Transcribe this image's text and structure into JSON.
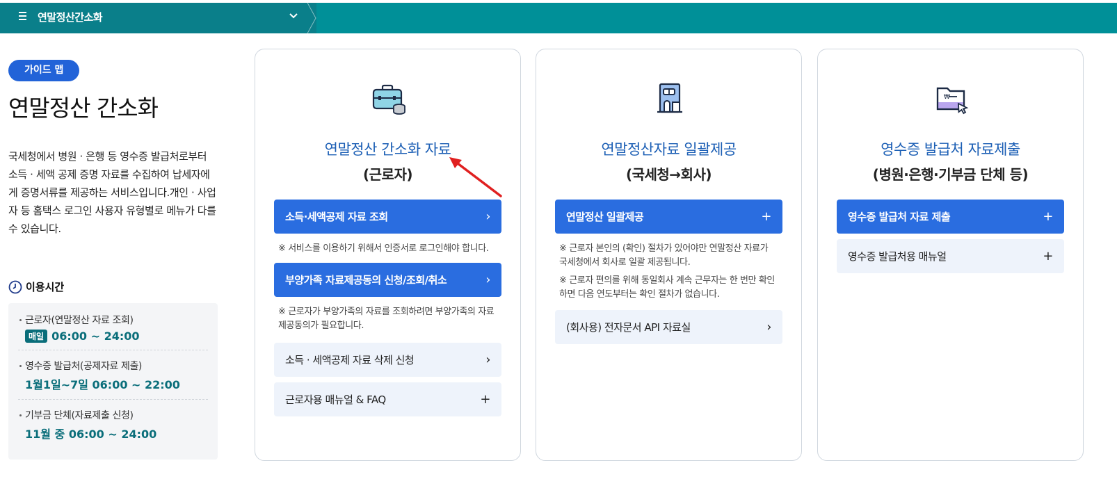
{
  "topbar": {
    "title": "연말정산간소화"
  },
  "left": {
    "badge": "가이드 맵",
    "title": "연말정산 간소화",
    "description": "국세청에서 병원 · 은행 등 영수증 발급처로부터 소득 · 세액 공제 증명 자료를 수집하여 납세자에게 증명서류를 제공하는 서비스입니다.개인 · 사업자 등 홈택스 로그인 사용자 유형별로 메뉴가 다를 수 있습니다.",
    "usage_heading": "이용시간",
    "usage": [
      {
        "label": "근로자(연말정산 자료 조회)",
        "tag": "매일",
        "time": "06:00 ~ 24:00"
      },
      {
        "label": "영수증 발급처(공제자료 제출)",
        "tag": "",
        "time": "1월1일~7일 06:00 ~ 22:00"
      },
      {
        "label": "기부금 단체(자료제출 신청)",
        "tag": "",
        "time": "11월 중 06:00 ~ 24:00"
      }
    ]
  },
  "cards": [
    {
      "icon": "briefcase-coins-icon",
      "title": "연말정산 간소화 자료",
      "subtitle": "(근로자)",
      "btn1": "소득·세액공제 자료 조회",
      "note1": "※ 서비스를 이용하기 위해서 인증서로 로그인해야 합니다.",
      "btn2": "부양가족 자료제공동의 신청/조회/취소",
      "note2": "※ 근로자가 부양가족의 자료를 조회하려면 부양가족의 자료 제공동의가 필요합니다.",
      "btn3": "소득 · 세액공제 자료 삭제 신청",
      "btn4": "근로자용 매뉴얼 & FAQ"
    },
    {
      "icon": "building-icon",
      "title": "연말정산자료 일괄제공",
      "subtitle": "(국세청→회사)",
      "btn1": "연말정산 일괄제공",
      "note1": "※ 근로자 본인의 (확인) 절차가 있어야만 연말정산 자료가 국세청에서 회사로 일괄 제공됩니다.",
      "note2": "※ 근로자 편의를 위해 동일회사 계속 근무자는 한 번만 확인하면 다음 연도부터는 확인 절차가 없습니다.",
      "btn2": "(회사용) 전자문서 API 자료실"
    },
    {
      "icon": "folder-cursor-icon",
      "title": "영수증 발급처 자료제출",
      "subtitle": "(병원·은행·기부금 단체 등)",
      "btn1": "영수증 발급처 자료 제출",
      "btn2": "영수증 발급처용 매뉴얼"
    }
  ],
  "colors": {
    "topbar": "#009098",
    "primary_button": "#2a6de0",
    "light_button": "#eef3fb",
    "card_title": "#1c5fb5",
    "time_text": "#0a6e7a",
    "annotation_arrow": "#e02020"
  }
}
